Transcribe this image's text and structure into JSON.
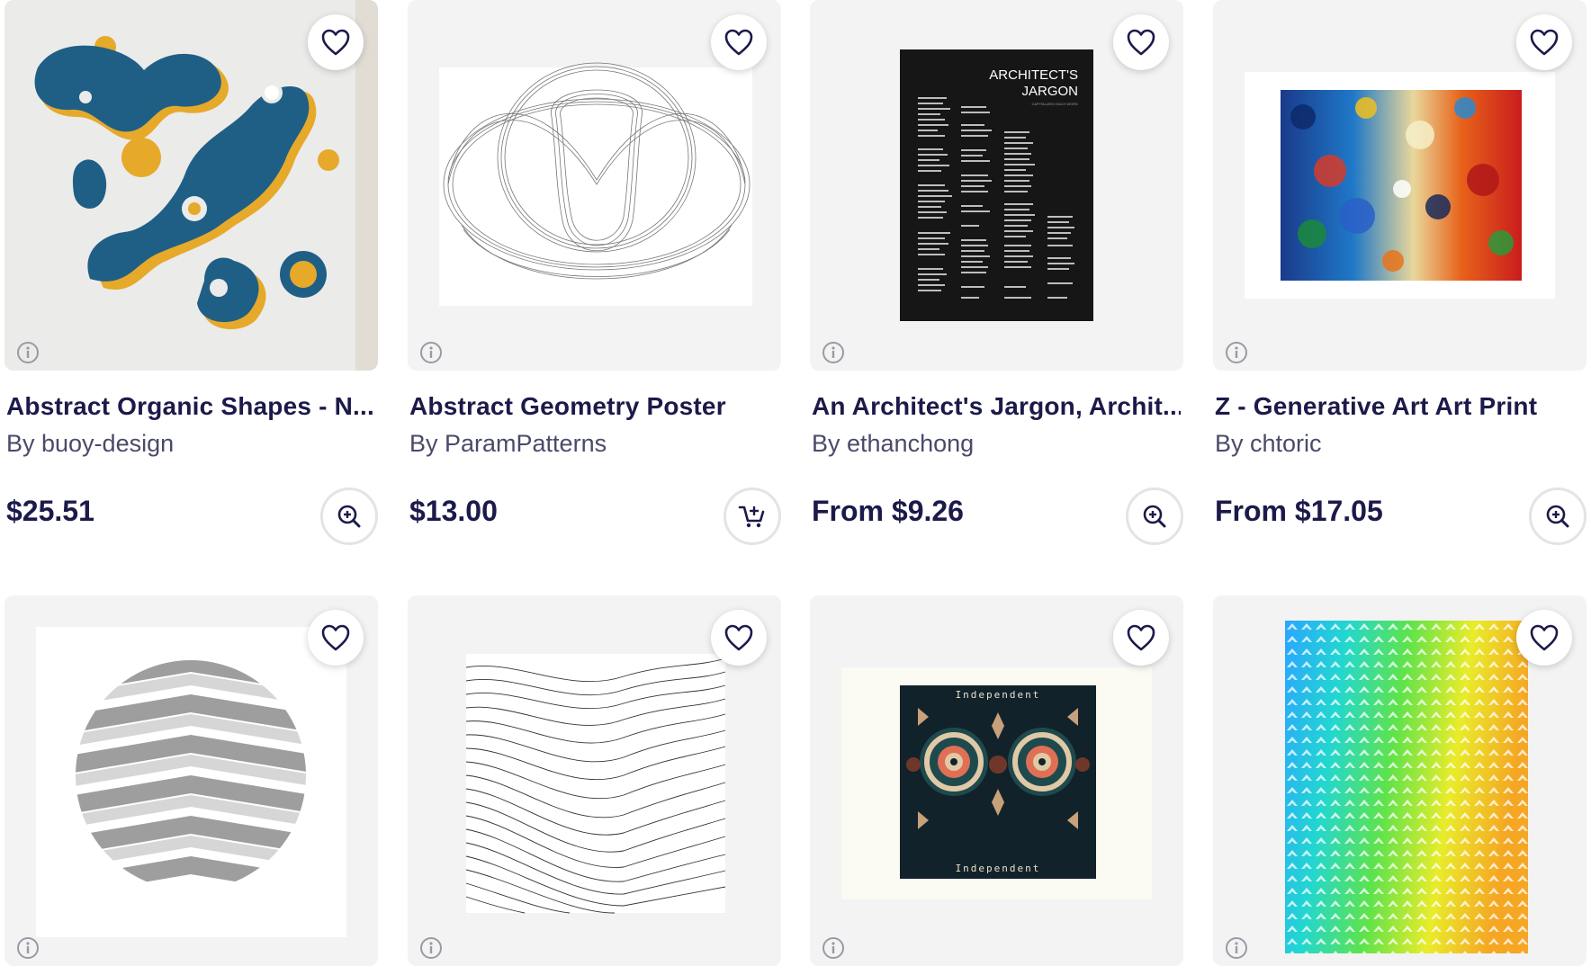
{
  "products": [
    {
      "title": "Abstract Organic Shapes - N...",
      "artist": "By buoy-design",
      "price": "$25.51",
      "action_icon": "zoom-in-icon"
    },
    {
      "title": "Abstract Geometry Poster",
      "artist": "By ParamPatterns",
      "price": "$13.00",
      "action_icon": "add-to-cart-icon"
    },
    {
      "title": "An Architect's Jargon, Archit...",
      "artist": "By ethanchong",
      "price": "From $9.26",
      "action_icon": "zoom-in-icon"
    },
    {
      "title": "Z - Generative Art Art Print",
      "artist": "By chtoric",
      "price": "From $17.05",
      "action_icon": "zoom-in-icon"
    },
    {
      "title": "",
      "artist": "",
      "price": ""
    },
    {
      "title": "",
      "artist": "",
      "price": ""
    },
    {
      "title": "",
      "artist": "",
      "price": ""
    },
    {
      "title": "",
      "artist": "",
      "price": ""
    }
  ],
  "artwork_text": {
    "poster_title": "ARCHITECT'S\nJARGON",
    "poster_subtitle": "CAPITALIZED EACH WORD",
    "independent_label": "Independent"
  },
  "colors": {
    "text_primary": "#1b1a4a",
    "text_secondary": "#4a4a6a",
    "card_bg": "#f3f3f3",
    "organic_blue": "#1f5f86",
    "organic_yellow": "#e6a92a"
  },
  "icons": {
    "favorite": "heart-outline-icon",
    "info": "info-circle-icon",
    "zoom": "zoom-in-icon",
    "cart": "add-to-cart-icon"
  }
}
